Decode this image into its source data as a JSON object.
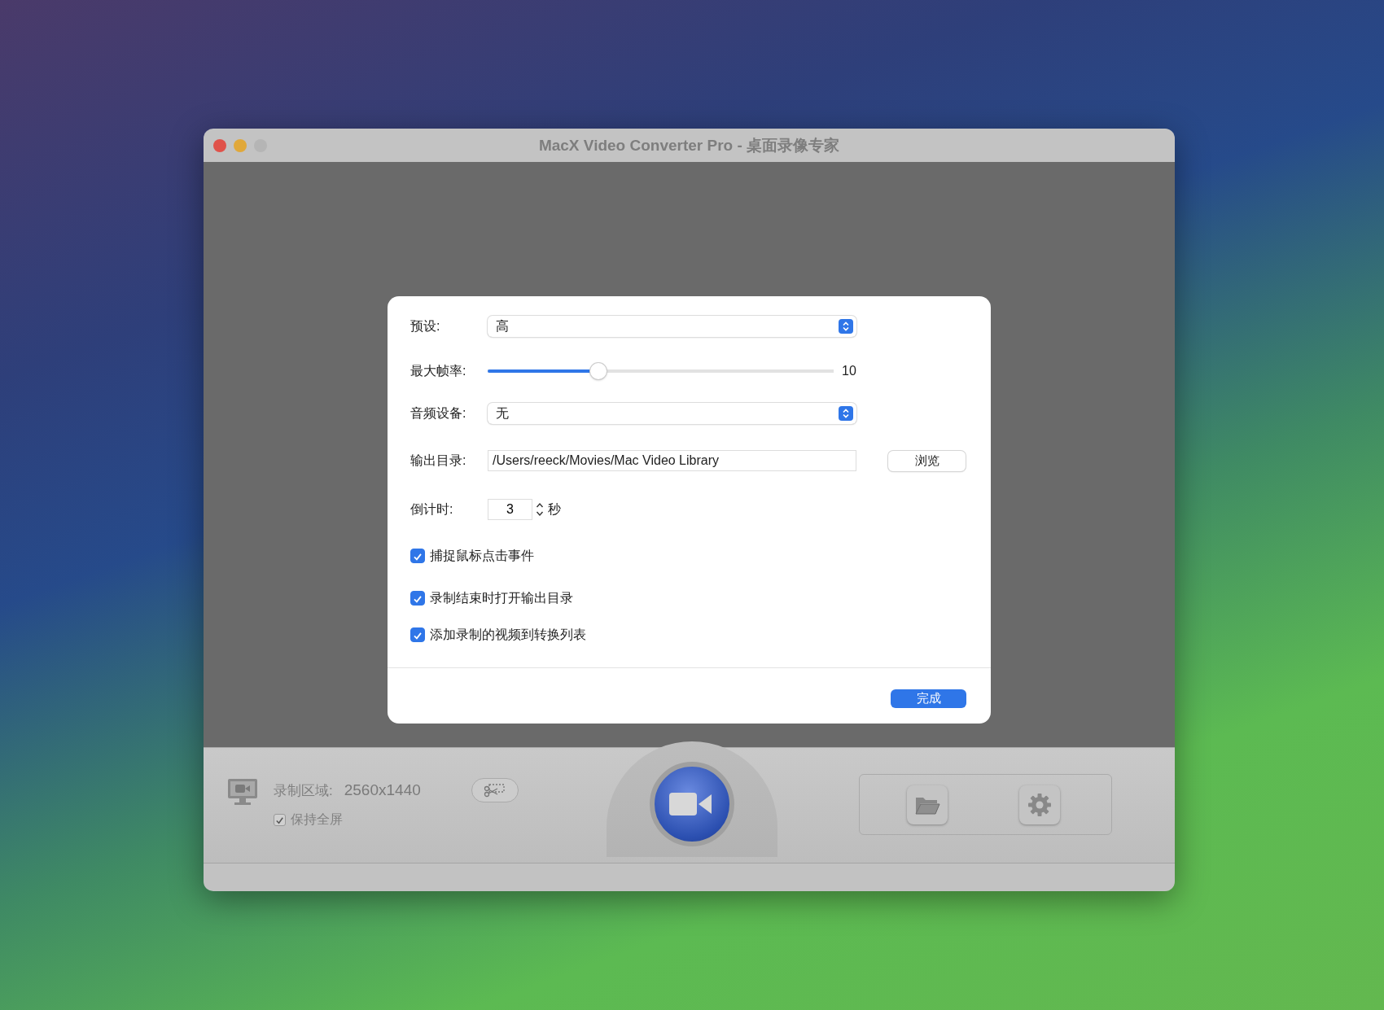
{
  "window": {
    "title": "MacX Video Converter Pro - 桌面录像专家"
  },
  "dialog": {
    "preset": {
      "label": "预设:",
      "value": "高"
    },
    "max_frame_rate": {
      "label": "最大帧率:",
      "level": 0.32,
      "reading": "10"
    },
    "audio_device": {
      "label": "音频设备:",
      "value": "无"
    },
    "output_dir": {
      "label": "输出目录:",
      "value": "/Users/reeck/Movies/Mac Video Library",
      "browse_button": "浏览"
    },
    "countdown": {
      "label": "倒计时:",
      "value": "3",
      "unit": "秒"
    },
    "options": [
      {
        "label": "捕捉鼠标点击事件",
        "checked": true
      },
      {
        "label": "录制结束时打开输出目录",
        "checked": true
      },
      {
        "label": "添加录制的视频到转换列表",
        "checked": true
      }
    ],
    "done_button": "完成"
  },
  "bottom_bar": {
    "area_label": "录制区域:",
    "area_value": "2560x1440",
    "keep_fullscreen": {
      "label": "保持全屏",
      "checked": true
    }
  }
}
